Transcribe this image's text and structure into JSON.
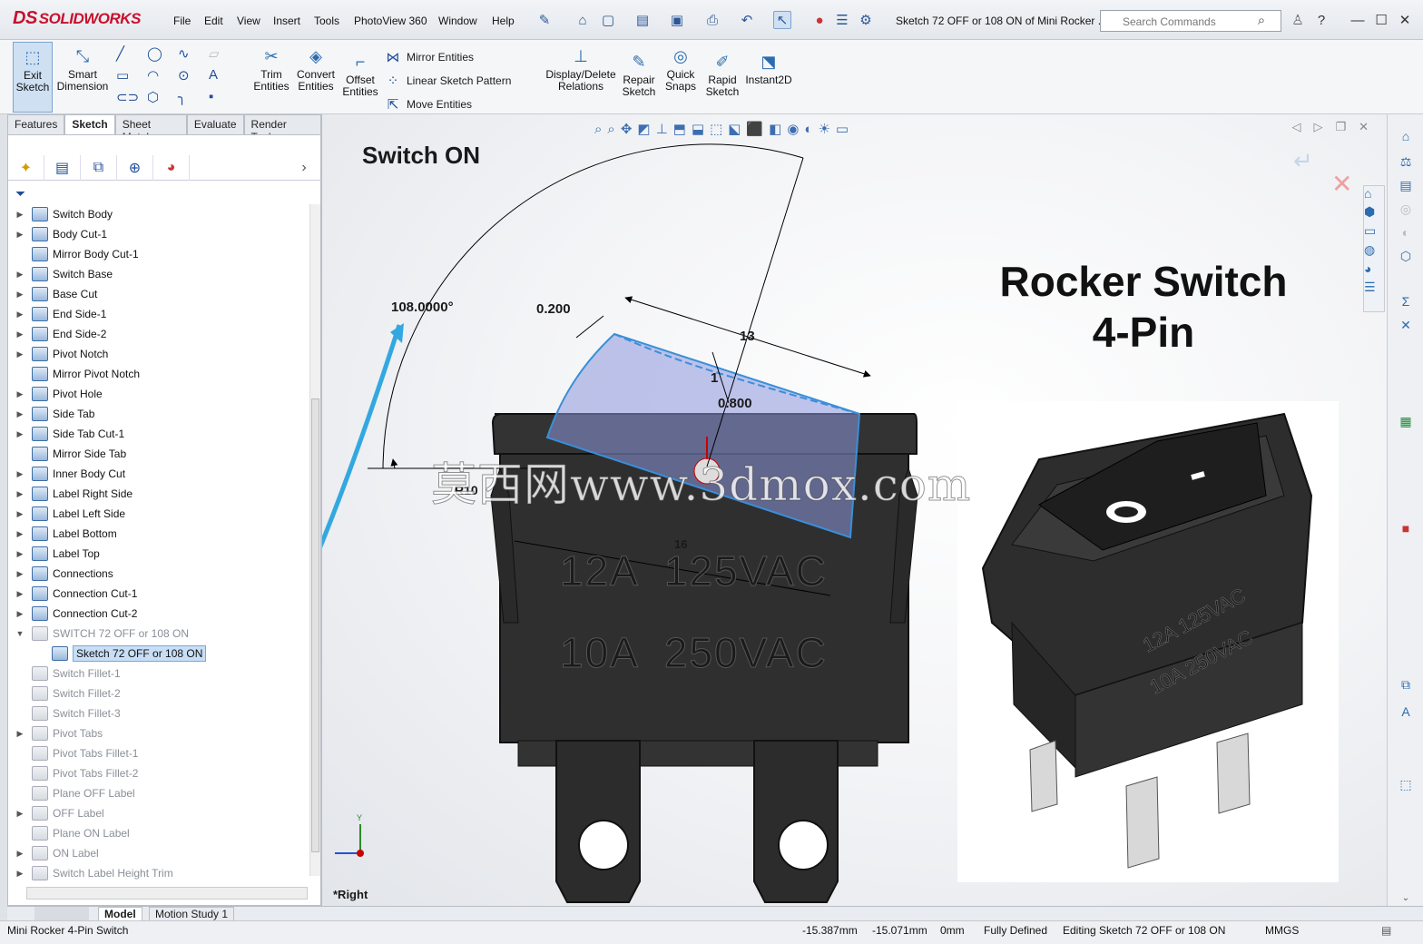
{
  "app": {
    "brand_mark": "DS",
    "brand_name": "SOLIDWORKS",
    "doc_title": "Sketch 72 OFF or 108 ON of Mini Rocker ...",
    "search_placeholder": "Search Commands"
  },
  "menu": [
    "File",
    "Edit",
    "View",
    "Insert",
    "Tools",
    "PhotoView 360",
    "Window",
    "Help"
  ],
  "ribbon": {
    "exit_sketch": "Exit\nSketch",
    "smart_dimension": "Smart\nDimension",
    "trim_entities": "Trim\nEntities",
    "convert_entities": "Convert\nEntities",
    "offset_entities": "Offset\nEntities",
    "mirror_entities": "Mirror Entities",
    "linear_pattern": "Linear Sketch Pattern",
    "move_entities": "Move Entities",
    "display_relations": "Display/Delete\nRelations",
    "repair_sketch": "Repair\nSketch",
    "quick_snaps": "Quick\nSnaps",
    "rapid_sketch": "Rapid\nSketch",
    "instant2d": "Instant2D"
  },
  "cm_tabs": [
    "Features",
    "Sketch",
    "Sheet Metal",
    "Evaluate",
    "Render Tools"
  ],
  "tree": [
    {
      "label": "Switch Body",
      "exp": true,
      "dim": false
    },
    {
      "label": "Body Cut-1",
      "exp": true,
      "dim": false
    },
    {
      "label": "Mirror Body Cut-1",
      "exp": false,
      "dim": false
    },
    {
      "label": "Switch Base",
      "exp": true,
      "dim": false
    },
    {
      "label": "Base Cut",
      "exp": true,
      "dim": false
    },
    {
      "label": "End Side-1",
      "exp": true,
      "dim": false
    },
    {
      "label": "End Side-2",
      "exp": true,
      "dim": false
    },
    {
      "label": "Pivot Notch",
      "exp": true,
      "dim": false
    },
    {
      "label": "Mirror Pivot Notch",
      "exp": false,
      "dim": false
    },
    {
      "label": "Pivot Hole",
      "exp": true,
      "dim": false
    },
    {
      "label": "Side Tab",
      "exp": true,
      "dim": false
    },
    {
      "label": "Side Tab Cut-1",
      "exp": true,
      "dim": false
    },
    {
      "label": "Mirror Side Tab",
      "exp": false,
      "dim": false
    },
    {
      "label": "Inner Body Cut",
      "exp": true,
      "dim": false
    },
    {
      "label": "Label Right Side",
      "exp": true,
      "dim": false
    },
    {
      "label": "Label Left Side",
      "exp": true,
      "dim": false
    },
    {
      "label": "Label Bottom",
      "exp": true,
      "dim": false
    },
    {
      "label": "Label Top",
      "exp": true,
      "dim": false
    },
    {
      "label": "Connections",
      "exp": true,
      "dim": false
    },
    {
      "label": "Connection Cut-1",
      "exp": true,
      "dim": false
    },
    {
      "label": "Connection Cut-2",
      "exp": true,
      "dim": false
    },
    {
      "label": "SWITCH 72 OFF or 108 ON",
      "exp": true,
      "dim": true,
      "open": true
    },
    {
      "label": "Sketch 72 OFF or 108 ON",
      "exp": false,
      "dim": false,
      "sel": true,
      "indent": true
    },
    {
      "label": "Switch Fillet-1",
      "exp": false,
      "dim": true
    },
    {
      "label": "Switch Fillet-2",
      "exp": false,
      "dim": true
    },
    {
      "label": "Switch Fillet-3",
      "exp": false,
      "dim": true
    },
    {
      "label": "Pivot Tabs",
      "exp": true,
      "dim": true
    },
    {
      "label": "Pivot Tabs Fillet-1",
      "exp": false,
      "dim": true
    },
    {
      "label": "Pivot Tabs Fillet-2",
      "exp": false,
      "dim": true
    },
    {
      "label": "Plane OFF Label",
      "exp": false,
      "dim": true
    },
    {
      "label": "OFF Label",
      "exp": true,
      "dim": true
    },
    {
      "label": "Plane ON Label",
      "exp": false,
      "dim": true
    },
    {
      "label": "ON Label",
      "exp": true,
      "dim": true
    },
    {
      "label": "Switch Label Height Trim",
      "exp": true,
      "dim": true
    }
  ],
  "viewport": {
    "heading": "Switch ON",
    "title_line1": "Rocker Switch",
    "title_line2": "4-Pin",
    "dim_angle": "108.0000°",
    "dim_0200": "0.200",
    "dim_13": "13",
    "dim_1": "1",
    "dim_0800": "0.800",
    "dim_16": "16",
    "dim_r10": "R10",
    "label_line1": "12A  125VAC",
    "label_line2": "10A  250VAC",
    "photo_on": "I",
    "photo_label1": "12A 125VAC",
    "photo_label2": "10A 250VAC",
    "watermark": "莫西网www.3dmox.com",
    "view_name": "*Right",
    "triad_y": "Y"
  },
  "bottom_tabs": [
    "Model",
    "Motion Study 1"
  ],
  "status": {
    "doc": "Mini Rocker 4-Pin Switch",
    "x": "-15.387mm",
    "y": "-15.071mm",
    "z": "0mm",
    "state": "Fully Defined",
    "editing": "Editing Sketch 72 OFF or 108 ON",
    "units": "MMGS"
  },
  "colors": {
    "accent": "#2b6cb0",
    "sketch_blue": "#3a8fd8",
    "arrow_blue": "#33a8e0",
    "brand": "#c8102e"
  }
}
